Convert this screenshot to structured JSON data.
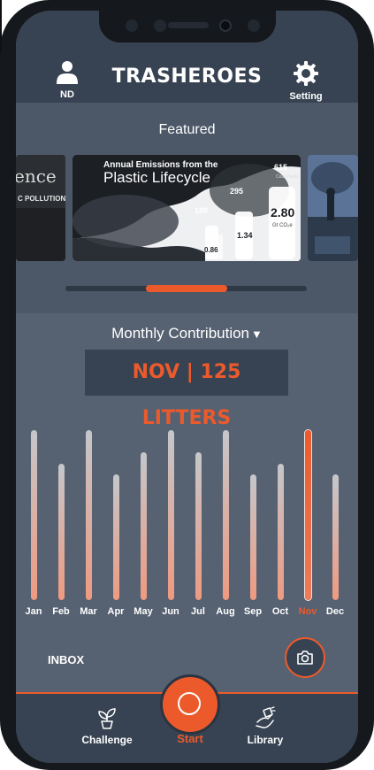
{
  "header": {
    "title": "TRASHEROES",
    "user_label": "ND",
    "settings_label": "Setting"
  },
  "featured": {
    "title": "Featured",
    "cards": [
      {
        "text_partial": "ence",
        "subtext_partial": "C POLLUTION"
      },
      {
        "headline": "Annual Emissions from the",
        "title": "Plastic Lifecycle",
        "stats": [
          "615",
          "295",
          "189",
          "2.80",
          "1.34",
          "0.86"
        ],
        "stat_sublabels": [
          "Coal Plants",
          "Gt CO₂e"
        ]
      },
      {
        "description": ""
      }
    ],
    "carousel_position": 0.5
  },
  "monthly": {
    "title": "Monthly Contribution",
    "summary": "NOV | 125 LITTERS",
    "selected_month": "Nov",
    "months": [
      "Jan",
      "Feb",
      "Mar",
      "Apr",
      "May",
      "Jun",
      "Jul",
      "Aug",
      "Sep",
      "Oct",
      "Nov",
      "Dec"
    ],
    "levels": [
      1.0,
      0.8,
      1.0,
      0.74,
      0.87,
      1.0,
      0.87,
      1.0,
      0.74,
      0.8,
      1.0,
      0.74
    ],
    "inbox_label": "INBOX"
  },
  "nav": {
    "challenge_label": "Challenge",
    "start_label": "Start",
    "library_label": "Library"
  },
  "colors": {
    "accent": "#ec5a2c",
    "header_bg": "#374352",
    "section_bg": "#4c5868",
    "content_bg": "#566171"
  },
  "icons": [
    "user-icon",
    "gear-icon",
    "camera-icon",
    "plant-icon",
    "start-circle-icon",
    "library-hand-icon"
  ]
}
